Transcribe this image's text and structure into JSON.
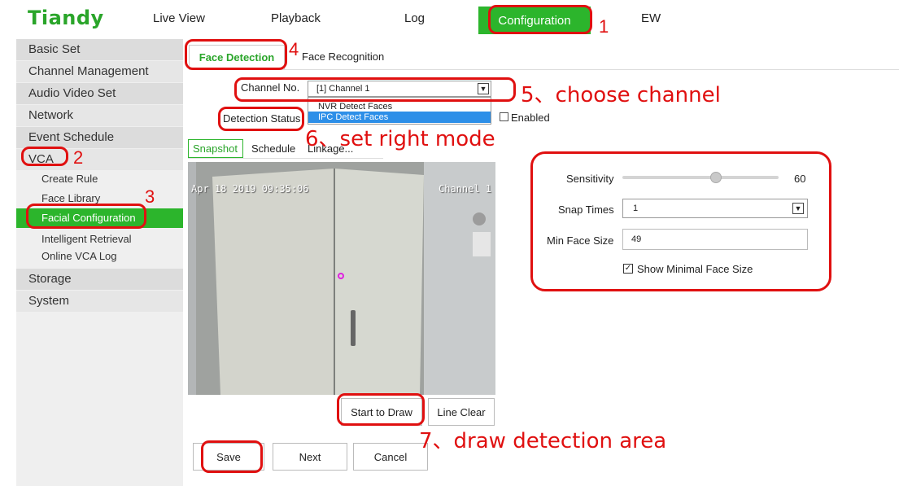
{
  "brand": {
    "logo_text": "Tiandy",
    "accent": "#2cb52c"
  },
  "nav": {
    "live_view": "Live View",
    "playback": "Playback",
    "log": "Log",
    "configuration": "Configuration",
    "ew": "EW"
  },
  "sidebar": {
    "items": {
      "basic_set": "Basic Set",
      "channel_management": "Channel Management",
      "audio_video_set": "Audio Video Set",
      "network": "Network",
      "event_schedule": "Event Schedule",
      "vca": "VCA",
      "storage": "Storage",
      "system": "System"
    },
    "vca_sub": {
      "create_rule": "Create Rule",
      "face_library": "Face Library",
      "facial_configuration": "Facial Configuration",
      "intelligent_retrieval": "Intelligent Retrieval",
      "online_vca_log": "Online VCA Log"
    }
  },
  "tabs": {
    "face_detection": "Face Detection",
    "face_recognition": "Face Recognition"
  },
  "form": {
    "channel_label": "Channel No.",
    "channel_value": "[1] Channel 1",
    "dropdown_options": [
      "NVR Detect Faces",
      "IPC Detect Faces"
    ],
    "dropdown_selected": "IPC Detect Faces",
    "detection_status_label": "Detection Status",
    "enabled_label": "Enabled"
  },
  "subtabs": {
    "snapshot": "Snapshot",
    "schedule": "Schedule",
    "linkage": "Linkage..."
  },
  "video": {
    "timestamp": "Apr 18 2019 09:35:06",
    "channel": "Channel 1"
  },
  "params": {
    "sensitivity_label": "Sensitivity",
    "sensitivity_value": "60",
    "sensitivity_fraction": 0.6,
    "snap_times_label": "Snap Times",
    "snap_times_value": "1",
    "min_face_size_label": "Min Face Size",
    "min_face_size_value": "49",
    "show_minimal_label": "Show Minimal Face Size",
    "show_minimal_checked": true
  },
  "buttons": {
    "start_to_draw": "Start to Draw",
    "line_clear": "Line Clear",
    "save": "Save",
    "next": "Next",
    "cancel": "Cancel"
  },
  "annotations": {
    "n1": "1",
    "n2": "2",
    "n3": "3",
    "n4": "4",
    "n5": "5、choose channel",
    "n6": "6、set right mode",
    "n7": "7、draw detection area",
    "color": "#e01010"
  }
}
